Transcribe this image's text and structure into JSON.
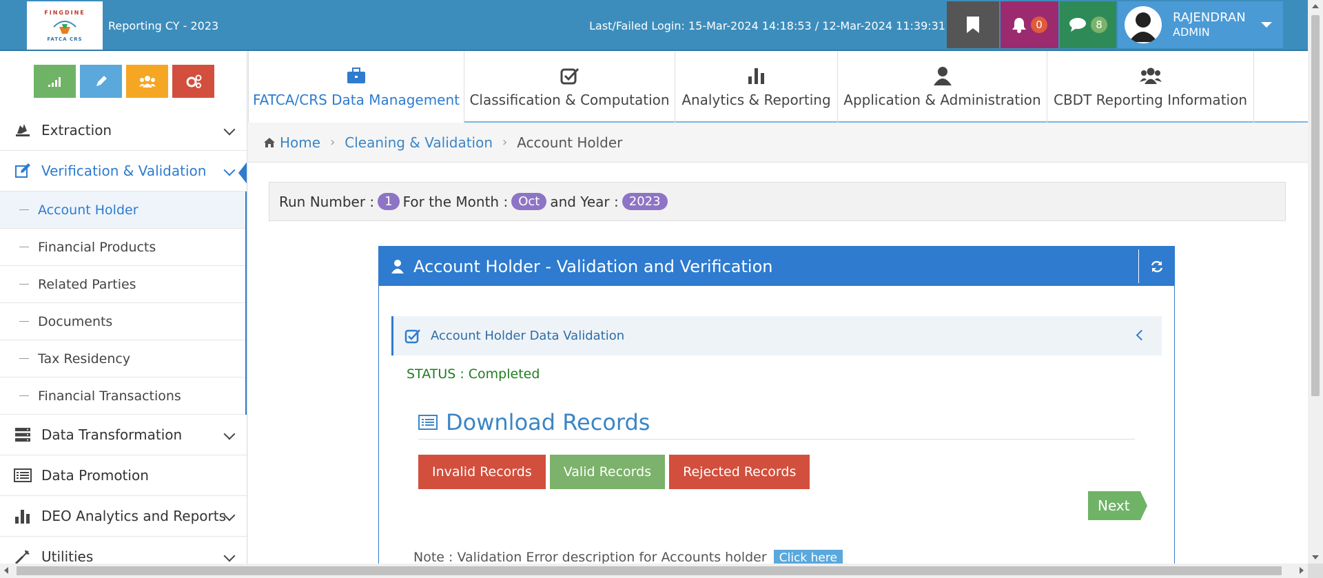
{
  "topbar": {
    "logo_text": "FINGDINE",
    "logo_sub": "FATCA CRS",
    "reporting_label": "Reporting CY - 2023",
    "last_login": "Last/Failed Login: 15-Mar-2024 14:18:53 / 12-Mar-2024 11:39:31",
    "notifications_count": "0",
    "messages_count": "8",
    "user_name": "RAJENDRAN",
    "user_role": "ADMIN",
    "colors": {
      "bar": "#3c8dbc",
      "bell": "#9b2b6e",
      "chat": "#2e8b57",
      "user": "#4a9ad6"
    }
  },
  "sidebar": {
    "quick_buttons": [
      {
        "icon": "signal-icon"
      },
      {
        "icon": "pencil-icon"
      },
      {
        "icon": "users-icon"
      },
      {
        "icon": "cogs-icon"
      }
    ],
    "items": [
      {
        "label": "Extraction",
        "icon": "extraction-icon"
      },
      {
        "label": "Verification & Validation",
        "icon": "edit-icon",
        "active": true
      },
      {
        "label": "Data Transformation",
        "icon": "server-icon"
      },
      {
        "label": "Data Promotion",
        "icon": "list-icon"
      },
      {
        "label": "DEO Analytics and Reports",
        "icon": "bar-chart-icon"
      },
      {
        "label": "Utilities",
        "icon": "tools-icon"
      }
    ],
    "subitems": [
      {
        "label": "Account Holder",
        "active": true
      },
      {
        "label": "Financial Products"
      },
      {
        "label": "Related Parties"
      },
      {
        "label": "Documents"
      },
      {
        "label": "Tax Residency"
      },
      {
        "label": "Financial Transactions"
      }
    ]
  },
  "tabs": [
    {
      "label": "FATCA/CRS Data Management",
      "icon": "briefcase-icon",
      "active": true
    },
    {
      "label": "Classification & Computation",
      "icon": "check-square-icon"
    },
    {
      "label": "Analytics & Reporting",
      "icon": "bar-chart-icon"
    },
    {
      "label": "Application & Administration",
      "icon": "user-icon"
    },
    {
      "label": "CBDT Reporting Information",
      "icon": "users-icon"
    }
  ],
  "breadcrumb": {
    "home": "Home",
    "section": "Cleaning & Validation",
    "current": "Account Holder"
  },
  "runbar": {
    "run_label": "Run Number :",
    "run_value": "1",
    "month_label": "For the Month :",
    "month_value": "Oct",
    "year_label": "and Year :",
    "year_value": "2023"
  },
  "panel": {
    "title": "Account Holder - Validation and Verification",
    "validation_title": "Account Holder Data Validation",
    "status": "STATUS : Completed",
    "download_title": "Download Records",
    "buttons": {
      "invalid": "Invalid Records",
      "valid": "Valid Records",
      "rejected": "Rejected Records",
      "next": "Next"
    },
    "note": "Note : Validation Error description for Accounts holder",
    "click_here": "Click here"
  }
}
